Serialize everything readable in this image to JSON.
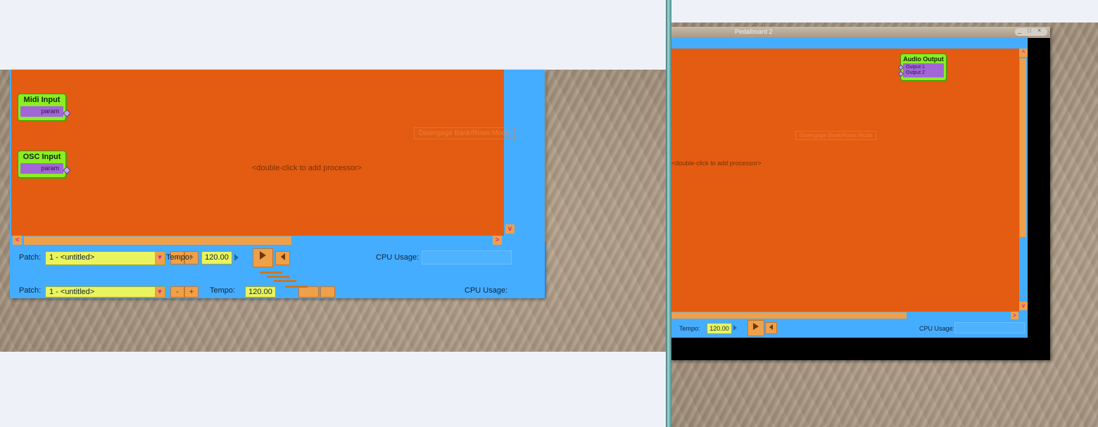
{
  "left_window": {
    "nodes": [
      {
        "title": "Midi Input",
        "port": "param"
      },
      {
        "title": "OSC Input",
        "port": "param"
      }
    ],
    "canvas_hint": "<double-click to add processor>",
    "ghost_button": "Disengage Bank/Rows Mode",
    "transport": {
      "patch_label": "Patch:",
      "patch_value": "1 - <untitled>",
      "minus": "-",
      "plus": "+",
      "tempo_label": "Tempo:",
      "tempo_value": "120.00",
      "cpu_label": "CPU Usage:"
    },
    "ghost_transport": {
      "patch_label": "Patch:",
      "patch_value": "1 - <untitled>",
      "minus": "-",
      "plus": "+",
      "tempo_label": "Tempo:",
      "tempo_value": "120.00",
      "cpu_label": "CPU Usage:"
    }
  },
  "right_window": {
    "title": "Pedalboard 2",
    "title_buttons": [
      "_",
      "□",
      "×"
    ],
    "node": {
      "title": "Audio Output",
      "ports": [
        "Output 1",
        "Output 2"
      ]
    },
    "canvas_hint": "<double-click to add processor>",
    "ghost_button": "Disengage Bank/Rows Mode",
    "transport": {
      "tempo_label": "Tempo:",
      "tempo_value": "120.00",
      "cpu_label": "CPU Usage:"
    }
  },
  "scroll_arrows": {
    "left": "<",
    "right": ">",
    "up": "^",
    "down": "v"
  },
  "colors": {
    "canvas": "#e35c12",
    "panel": "#45adff",
    "node": "#8aee22",
    "port": "#a266d6",
    "field": "#eaf45e",
    "button": "#f0a048"
  }
}
